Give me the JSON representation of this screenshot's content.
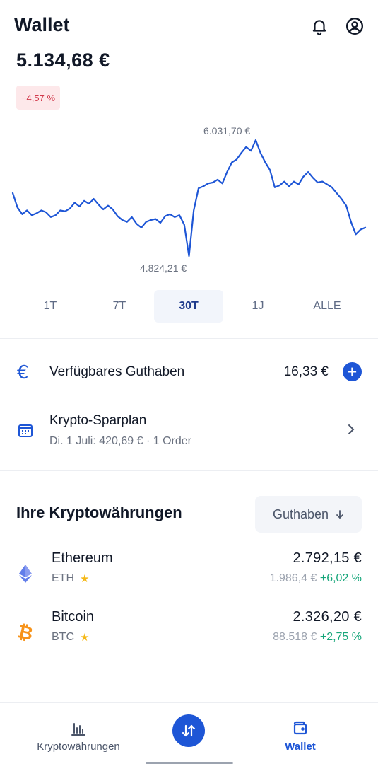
{
  "header": {
    "title": "Wallet",
    "icons": [
      "bell-icon",
      "account-icon"
    ]
  },
  "portfolio": {
    "balance": "5.134,68 €",
    "change": "−4,57 %",
    "change_color": "#d23a4c"
  },
  "chart_data": {
    "type": "line",
    "title": "",
    "max_label": "6.031,70 €",
    "min_label": "4.824,21 €",
    "line_color": "#1e56d6",
    "ylim": [
      4824.21,
      6031.7
    ],
    "grid": false,
    "series": [
      {
        "values": [
          5480,
          5330,
          5260,
          5300,
          5250,
          5270,
          5300,
          5280,
          5230,
          5250,
          5300,
          5290,
          5320,
          5380,
          5340,
          5400,
          5370,
          5420,
          5360,
          5310,
          5350,
          5310,
          5240,
          5200,
          5180,
          5230,
          5160,
          5120,
          5180,
          5200,
          5210,
          5170,
          5240,
          5260,
          5230,
          5250,
          5150,
          4824,
          5300,
          5530,
          5550,
          5580,
          5590,
          5620,
          5580,
          5700,
          5800,
          5830,
          5900,
          5960,
          5920,
          6031,
          5900,
          5800,
          5720,
          5540,
          5560,
          5600,
          5550,
          5600,
          5570,
          5650,
          5700,
          5640,
          5590,
          5600,
          5570,
          5540,
          5480,
          5420,
          5350,
          5180,
          5050,
          5100,
          5120
        ]
      }
    ]
  },
  "ranges": {
    "options": [
      "1T",
      "7T",
      "30T",
      "1J",
      "ALLE"
    ],
    "selected": "30T"
  },
  "available": {
    "label": "Verfügbares Guthaben",
    "value": "16,33 €",
    "icon": "euro-icon"
  },
  "savings_plan": {
    "label": "Krypto-Sparplan",
    "subtitle": "Di. 1 Juli: 420,69 € · 1 Order",
    "icon": "calendar-icon"
  },
  "assets_section": {
    "title": "Ihre Kryptowährungen",
    "sort_label": "Guthaben",
    "sort_icon": "arrow-down-icon"
  },
  "assets": [
    {
      "name": "Ethereum",
      "symbol": "ETH",
      "value": "2.792,15 €",
      "price": "1.986,4 €",
      "change": "+6,02 %",
      "icon": "ethereum-icon",
      "color": "#627eea"
    },
    {
      "name": "Bitcoin",
      "symbol": "BTC",
      "value": "2.326,20 €",
      "price": "88.518 €",
      "change": "+2,75 %",
      "icon": "bitcoin-icon",
      "color": "#f7931a"
    }
  ],
  "tabbar": {
    "crypto_label": "Kryptowährungen",
    "wallet_label": "Wallet",
    "active": "Wallet",
    "accent": "#1e56d6"
  }
}
